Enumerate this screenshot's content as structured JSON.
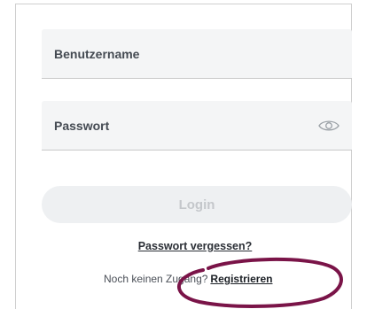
{
  "login_form": {
    "username_placeholder": "Benutzername",
    "password_placeholder": "Passwort",
    "password_toggle_icon": "eye-icon",
    "login_label": "Login",
    "forgot_password_label": "Passwort vergessen?",
    "no_account_text": "Noch keinen Zugang?",
    "register_label": "Registrieren"
  },
  "colors": {
    "field_background": "#f4f5f6",
    "button_disabled_background": "#eef0f2",
    "annotation_ring": "#7a1448"
  }
}
